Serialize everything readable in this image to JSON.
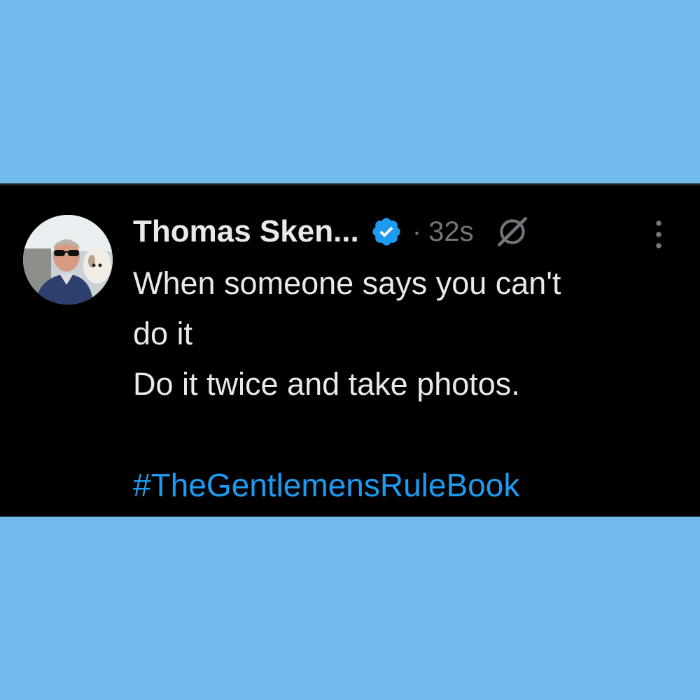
{
  "tweet": {
    "author": {
      "display_name": "Thomas Sken...",
      "avatar_icon": "profile-photo-man-with-dog",
      "verified_icon": "verified-badge-icon",
      "verified_color": "#1d9bf0"
    },
    "separator": "·",
    "timestamp": "32s",
    "grok_icon": "grok-icon",
    "more_icon": "more-options-vertical-icon",
    "text_lines": [
      "When someone says you can't",
      "do it",
      "Do it twice and take photos."
    ],
    "hashtag": "#TheGentlemensRuleBook"
  },
  "colors": {
    "page_background": "#72b9ec",
    "card_background": "#000000",
    "primary_text": "#e7e9ea",
    "secondary_text": "#71767b",
    "link": "#1d9bf0"
  }
}
